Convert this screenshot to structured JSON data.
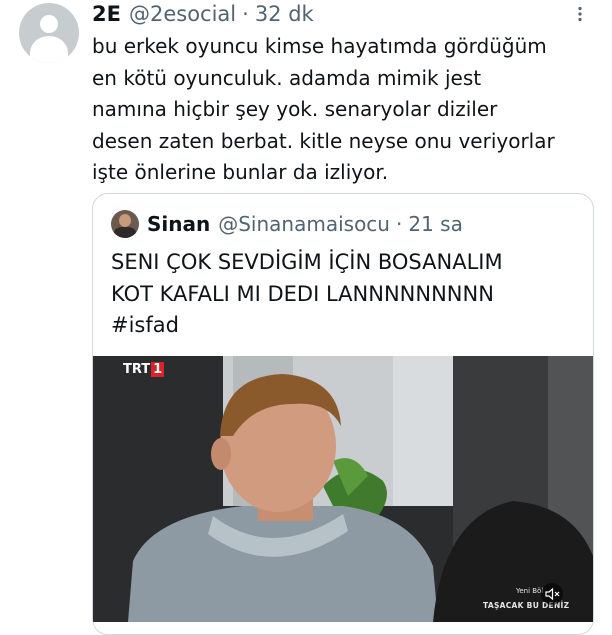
{
  "post": {
    "name": "2E",
    "handle": "@2esocial",
    "dot": "·",
    "time": "32 dk",
    "text": "bu erkek oyuncu kimse hayatımda gördüğüm\nen kötü oyunculuk. adamda mimik jest\nnamına hiçbir şey yok. senaryolar diziler\ndesen zaten berbat. kitle neyse onu veriyorlar\nişte önlerine bunlar da izliyor."
  },
  "quote": {
    "name": "Sinan",
    "handle": "@Sinanamaisocu",
    "dot": "·",
    "time": "21 sa",
    "text": "SENI ÇOK SEVDİGİM İÇİN BOSANALIM\nKOT KAFALI MI DEDI LANNNNNNNNN\n#isfad"
  },
  "media": {
    "channel_logo": "TRT",
    "channel_number": "1",
    "caption_top": "Yeni Böl",
    "caption_bottom": "TAŞACAK BU DENİZ",
    "mute_icon": "speaker-mute-icon"
  },
  "icons": {
    "more": "more-options-icon"
  }
}
